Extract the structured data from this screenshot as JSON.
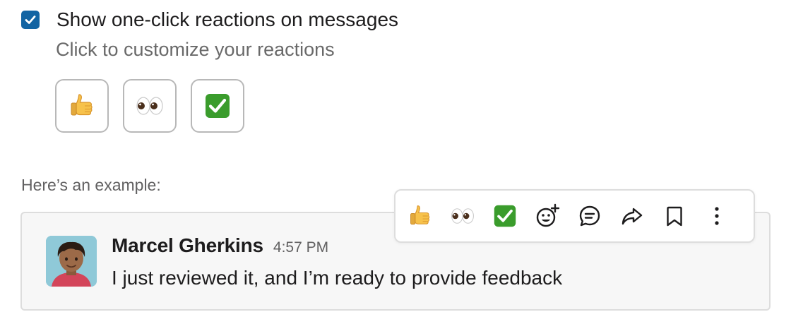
{
  "settings": {
    "checkbox_checked": true,
    "checkbox_label": "Show one-click reactions on messages",
    "subtext": "Click to customize your reactions",
    "reactions": [
      {
        "icon": "thumbs-up-emoji"
      },
      {
        "icon": "eyes-emoji"
      },
      {
        "icon": "check-mark-button-emoji"
      }
    ]
  },
  "example": {
    "label": "Here’s an example:",
    "message": {
      "author": "Marcel Gherkins",
      "timestamp": "4:57 PM",
      "text": "I just reviewed it, and I’m ready to provide feedback"
    },
    "toolbar": {
      "items": [
        {
          "icon": "thumbs-up-emoji"
        },
        {
          "icon": "eyes-emoji"
        },
        {
          "icon": "check-mark-button-emoji"
        },
        {
          "icon": "add-reaction-icon"
        },
        {
          "icon": "reply-in-thread-icon"
        },
        {
          "icon": "share-forward-icon"
        },
        {
          "icon": "bookmark-icon"
        },
        {
          "icon": "more-actions-icon"
        }
      ]
    }
  },
  "colors": {
    "accent": "#1264a3",
    "check_green": "#3a9c2c",
    "muted_text": "#696969",
    "card_bg": "#f7f7f7"
  }
}
